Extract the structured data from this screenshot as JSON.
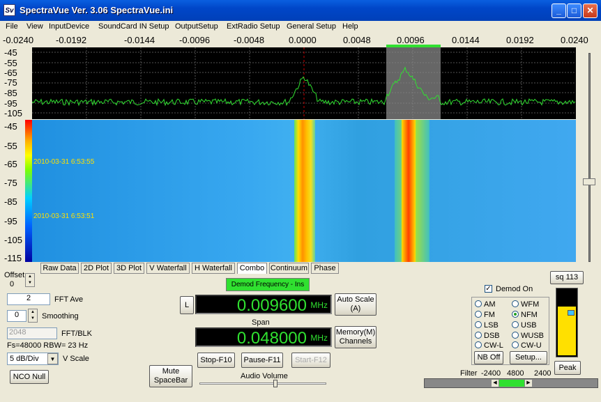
{
  "window": {
    "title": "SpectraVue Ver. 3.06  SpectraVue.ini",
    "icon_text": "Sv"
  },
  "menu": [
    "File",
    "View",
    "InputDevice",
    "SoundCard IN Setup",
    "OutputSetup",
    "ExtRadio Setup",
    "General Setup",
    "Help"
  ],
  "freq_axis": [
    "-0.0240",
    "-0.0192",
    "-0.0144",
    "-0.0096",
    "-0.0048",
    "0.0000",
    "0.0048",
    "0.0096",
    "0.0144",
    "0.0192",
    "0.0240"
  ],
  "spectrum_db_axis": [
    "-45",
    "-55",
    "-65",
    "-75",
    "-85",
    "-95",
    "-105"
  ],
  "waterfall_db_axis": [
    "-45",
    "-55",
    "-65",
    "-75",
    "-85",
    "-95",
    "-105",
    "-115"
  ],
  "waterfall_timestamps": [
    "2010-03-31 6:53:55",
    "2010-03-31 6:53:51"
  ],
  "tabs": [
    "Raw Data",
    "2D Plot",
    "3D Plot",
    "V Waterfall",
    "H Waterfall",
    "Combo",
    "Continuum",
    "Phase"
  ],
  "active_tab": "Combo",
  "left_controls": {
    "offset_label": "Offset",
    "offset_value": "0",
    "fft_ave_value": "2",
    "fft_ave_label": "FFT Ave",
    "smoothing_value": "0",
    "smoothing_label": "Smoothing",
    "fft_blk_value": "2048",
    "fft_blk_label": "FFT/BLK",
    "fs_rbw": "Fs=48000 RBW=  23 Hz",
    "vscale_value": "5 dB/Div",
    "vscale_label": "V Scale",
    "nco_null": "NCO Null"
  },
  "demod_freq_label": "Demod Frequency - Ins",
  "l_button": "L",
  "demod_freq_value": "0.009600",
  "demod_freq_unit": "MHz",
  "auto_scale": "Auto Scale\n(A)",
  "span_label": "Span",
  "span_value": "0.048000",
  "span_unit": "MHz",
  "memory_channels": "Memory(M)\nChannels",
  "mute_button": "Mute\nSpaceBar",
  "stop_button": "Stop-F10",
  "pause_button": "Pause-F11",
  "start_button": "Start-F12",
  "audio_volume_label": "Audio Volume",
  "audio_volume_level": 0.6,
  "demod": {
    "on_label": "Demod On",
    "on_checked": true,
    "modes": [
      "AM",
      "WFM",
      "FM",
      "NFM",
      "LSB",
      "USB",
      "DSB",
      "WUSB",
      "CW-L",
      "CW-U"
    ],
    "selected": "NFM",
    "nb_button": "NB Off",
    "setup_button": "Setup..."
  },
  "squelch": {
    "label": "sq 113",
    "peak": "Peak",
    "level": 0.28
  },
  "filter": {
    "label": "Filter",
    "low": "-2400",
    "width": "4800",
    "high": "2400"
  },
  "colors": {
    "trace": "#30E030",
    "lcd_text": "#30E030",
    "demod_bar": "#30E030",
    "squelch_fill": "#FFE000"
  }
}
